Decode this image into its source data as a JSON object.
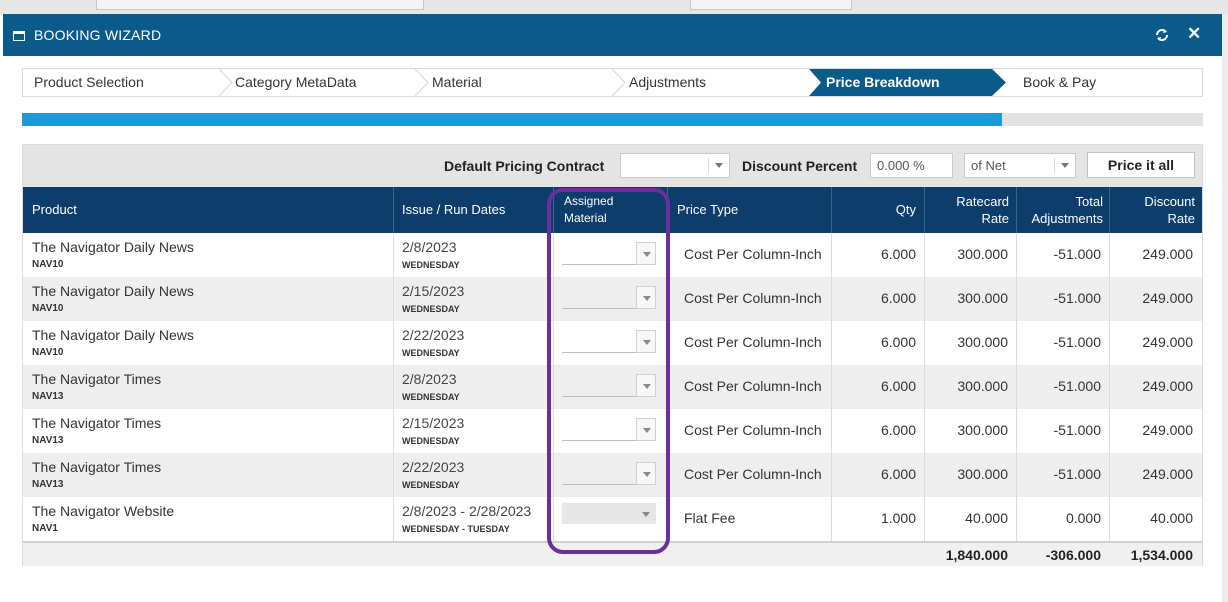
{
  "modal": {
    "title": "BOOKING WIZARD",
    "refresh_icon": "refresh-icon",
    "close_label": "✕"
  },
  "steps": [
    {
      "label": "Product Selection",
      "active": false
    },
    {
      "label": "Category MetaData",
      "active": false
    },
    {
      "label": "Material",
      "active": false
    },
    {
      "label": "Adjustments",
      "active": false
    },
    {
      "label": "Price Breakdown",
      "active": true
    },
    {
      "label": "Book & Pay",
      "active": false
    }
  ],
  "progress": {
    "fraction": 0.83
  },
  "toolbar": {
    "pricing_contract_label": "Default Pricing Contract",
    "pricing_contract_value": "",
    "discount_percent_label": "Discount Percent",
    "discount_percent_value": "0.000 %",
    "discount_basis_value": "of Net",
    "price_it_all_label": "Price it all"
  },
  "columns": {
    "product": "Product",
    "dates": "Issue / Run Dates",
    "material_1": "Assigned",
    "material_2": "Material",
    "price_type": "Price Type",
    "qty": "Qty",
    "ratecard_1": "Ratecard",
    "ratecard_2": "Rate",
    "adjust_1": "Total",
    "adjust_2": "Adjustments",
    "discount_1": "Discount",
    "discount_2": "Rate"
  },
  "rows": [
    {
      "product": "The Navigator Daily News",
      "code": "NAV10",
      "date": "2/8/2023",
      "day": "WEDNESDAY",
      "price_type": "Cost Per Column-Inch",
      "qty": "6.000",
      "ratecard": "300.000",
      "adjust": "-51.000",
      "discount": "249.000"
    },
    {
      "product": "The Navigator Daily News",
      "code": "NAV10",
      "date": "2/15/2023",
      "day": "WEDNESDAY",
      "price_type": "Cost Per Column-Inch",
      "qty": "6.000",
      "ratecard": "300.000",
      "adjust": "-51.000",
      "discount": "249.000"
    },
    {
      "product": "The Navigator Daily News",
      "code": "NAV10",
      "date": "2/22/2023",
      "day": "WEDNESDAY",
      "price_type": "Cost Per Column-Inch",
      "qty": "6.000",
      "ratecard": "300.000",
      "adjust": "-51.000",
      "discount": "249.000"
    },
    {
      "product": "The Navigator Times",
      "code": "NAV13",
      "date": "2/8/2023",
      "day": "WEDNESDAY",
      "price_type": "Cost Per Column-Inch",
      "qty": "6.000",
      "ratecard": "300.000",
      "adjust": "-51.000",
      "discount": "249.000"
    },
    {
      "product": "The Navigator Times",
      "code": "NAV13",
      "date": "2/15/2023",
      "day": "WEDNESDAY",
      "price_type": "Cost Per Column-Inch",
      "qty": "6.000",
      "ratecard": "300.000",
      "adjust": "-51.000",
      "discount": "249.000"
    },
    {
      "product": "The Navigator Times",
      "code": "NAV13",
      "date": "2/22/2023",
      "day": "WEDNESDAY",
      "price_type": "Cost Per Column-Inch",
      "qty": "6.000",
      "ratecard": "300.000",
      "adjust": "-51.000",
      "discount": "249.000"
    },
    {
      "product": "The Navigator Website",
      "code": "NAV1",
      "date": "2/8/2023 - 2/28/2023",
      "day": "WEDNESDAY - TUESDAY",
      "price_type": "Flat Fee",
      "qty": "1.000",
      "ratecard": "40.000",
      "adjust": "0.000",
      "discount": "40.000"
    }
  ],
  "totals": {
    "ratecard": "1,840.000",
    "adjust": "-306.000",
    "discount": "1,534.000"
  },
  "colors": {
    "title_bar": "#0a5b8a",
    "active_step": "#0a5b8a",
    "progress_fill": "#1e9ad8",
    "header": "#0d3d6b",
    "highlight": "#6b2f9b"
  }
}
